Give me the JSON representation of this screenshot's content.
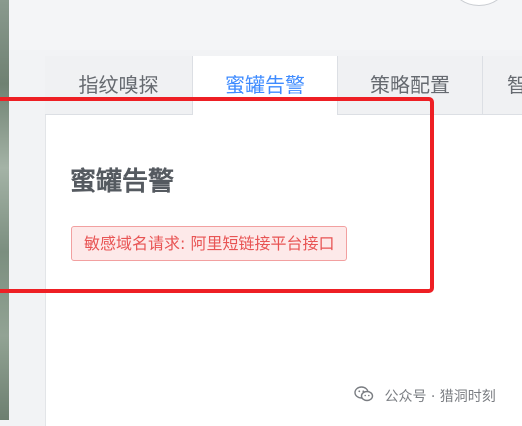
{
  "tabs": [
    {
      "label": "指纹嗅探"
    },
    {
      "label": "蜜罐告警"
    },
    {
      "label": "策略配置"
    },
    {
      "label": "智"
    }
  ],
  "content": {
    "title": "蜜罐告警",
    "alert": "敏感域名请求: 阿里短链接平台接口"
  },
  "watermark": {
    "text": "公众号 · 猎洞时刻",
    "icon": "wechat-icon"
  },
  "colors": {
    "active_tab": "#3e8bff",
    "alert_text": "#e85454",
    "alert_bg": "#fde9e9",
    "highlight_box": "#ee1f24"
  }
}
